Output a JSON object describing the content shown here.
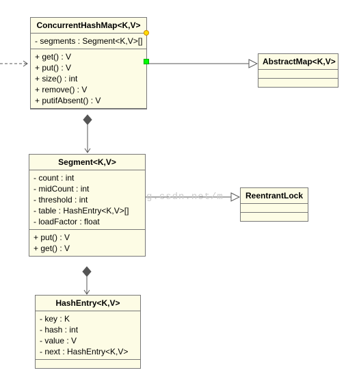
{
  "classes": {
    "concurrentHashMap": {
      "title": "ConcurrentHashMap<K,V>",
      "attrs": [
        "- segments : Segment<K,V>[]"
      ],
      "ops": [
        "+ get() : V",
        "+ put() : V",
        "+ size() : int",
        "+ remove() : V",
        "+ putifAbsent() : V"
      ]
    },
    "abstractMap": {
      "title": "AbstractMap<K,V>",
      "attrs": [],
      "ops": []
    },
    "segment": {
      "title": "Segment<K,V>",
      "attrs": [
        "- count : int",
        "- midCount : int",
        "- threshold : int",
        "- table : HashEntry<K,V>[]",
        "- loadFactor : float"
      ],
      "ops": [
        "+ put() : V",
        "+ get() : V"
      ]
    },
    "reentrantLock": {
      "title": "ReentrantLock",
      "attrs": [],
      "ops": []
    },
    "hashEntry": {
      "title": "HashEntry<K,V>",
      "attrs": [
        "- key : K",
        "- hash : int",
        "- value : V",
        "- next : HashEntry<K,V>"
      ],
      "ops": []
    }
  },
  "watermark": "http://blog.csdn.net/m",
  "chart_data": {
    "type": "uml-class-diagram",
    "classes": [
      {
        "name": "ConcurrentHashMap<K,V>",
        "attributes": [
          "- segments : Segment<K,V>[]"
        ],
        "operations": [
          "+ get() : V",
          "+ put() : V",
          "+ size() : int",
          "+ remove() : V",
          "+ putifAbsent() : V"
        ]
      },
      {
        "name": "AbstractMap<K,V>",
        "attributes": [],
        "operations": []
      },
      {
        "name": "Segment<K,V>",
        "attributes": [
          "- count : int",
          "- midCount : int",
          "- threshold : int",
          "- table : HashEntry<K,V>[]",
          "- loadFactor : float"
        ],
        "operations": [
          "+ put() : V",
          "+ get() : V"
        ]
      },
      {
        "name": "ReentrantLock",
        "attributes": [],
        "operations": []
      },
      {
        "name": "HashEntry<K,V>",
        "attributes": [
          "- key : K",
          "- hash : int",
          "- value : V",
          "- next : HashEntry<K,V>"
        ],
        "operations": []
      }
    ],
    "relations": [
      {
        "from": "ConcurrentHashMap<K,V>",
        "to": "AbstractMap<K,V>",
        "type": "generalization"
      },
      {
        "from": "ConcurrentHashMap<K,V>",
        "to": "Segment<K,V>",
        "type": "composition"
      },
      {
        "from": "Segment<K,V>",
        "to": "ReentrantLock",
        "type": "generalization"
      },
      {
        "from": "Segment<K,V>",
        "to": "HashEntry<K,V>",
        "type": "composition"
      }
    ]
  }
}
